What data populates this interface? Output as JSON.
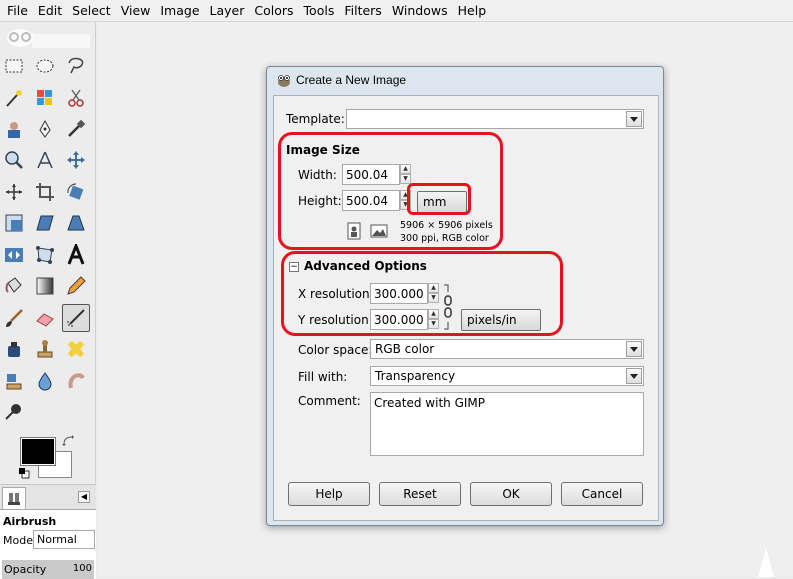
{
  "menubar": {
    "items": [
      "File",
      "Edit",
      "Select",
      "View",
      "Image",
      "Layer",
      "Colors",
      "Tools",
      "Filters",
      "Windows",
      "Help"
    ]
  },
  "toolbox": {
    "tools": [
      "rect-select-icon",
      "ellipse-select-icon",
      "free-select-icon",
      "fuzzy-select-icon",
      "color-select-icon",
      "scissors-select-icon",
      "foreground-select-icon",
      "paths-icon",
      "color-picker-icon",
      "zoom-icon",
      "measure-icon",
      "move-icon",
      "align-icon",
      "crop-icon",
      "rotate-icon",
      "scale-icon",
      "shear-icon",
      "perspective-icon",
      "flip-icon",
      "cage-transform-icon",
      "text-icon",
      "bucket-fill-icon",
      "blend-icon",
      "pencil-icon",
      "paintbrush-icon",
      "eraser-icon",
      "airbrush-icon",
      "ink-icon",
      "clone-icon",
      "heal-icon",
      "perspective-clone-icon",
      "blur-sharpen-icon",
      "smudge-icon",
      "dodge-burn-icon"
    ],
    "active_tool": "airbrush-icon",
    "colors": {
      "foreground": "#000000",
      "background": "#ffffff"
    },
    "tool_options": {
      "title": "Airbrush",
      "mode_label": "Mode:",
      "mode_value": "Normal",
      "opacity_label": "Opacity",
      "opacity_value": "100"
    }
  },
  "dialog": {
    "title": "Create a New Image",
    "template": {
      "label": "Template:",
      "value": ""
    },
    "image_size": {
      "heading": "Image Size",
      "width_label": "Width:",
      "width_value": "500.04",
      "height_label": "Height:",
      "height_value": "500.04",
      "unit": "mm",
      "info_line1": "5906 × 5906 pixels",
      "info_line2": "300 ppi, RGB color"
    },
    "advanced": {
      "heading": "Advanced Options",
      "x_res_label": "X resolution:",
      "x_res_value": "300.000",
      "y_res_label": "Y resolution:",
      "y_res_value": "300.000",
      "res_unit": "pixels/in"
    },
    "color_space": {
      "label": "Color space:",
      "value": "RGB color"
    },
    "fill_with": {
      "label": "Fill with:",
      "value": "Transparency"
    },
    "comment": {
      "label": "Comment:",
      "value": "Created with GIMP"
    },
    "buttons": {
      "help": "Help",
      "reset": "Reset",
      "ok": "OK",
      "cancel": "Cancel"
    },
    "highlight_color": "#e8121f"
  }
}
